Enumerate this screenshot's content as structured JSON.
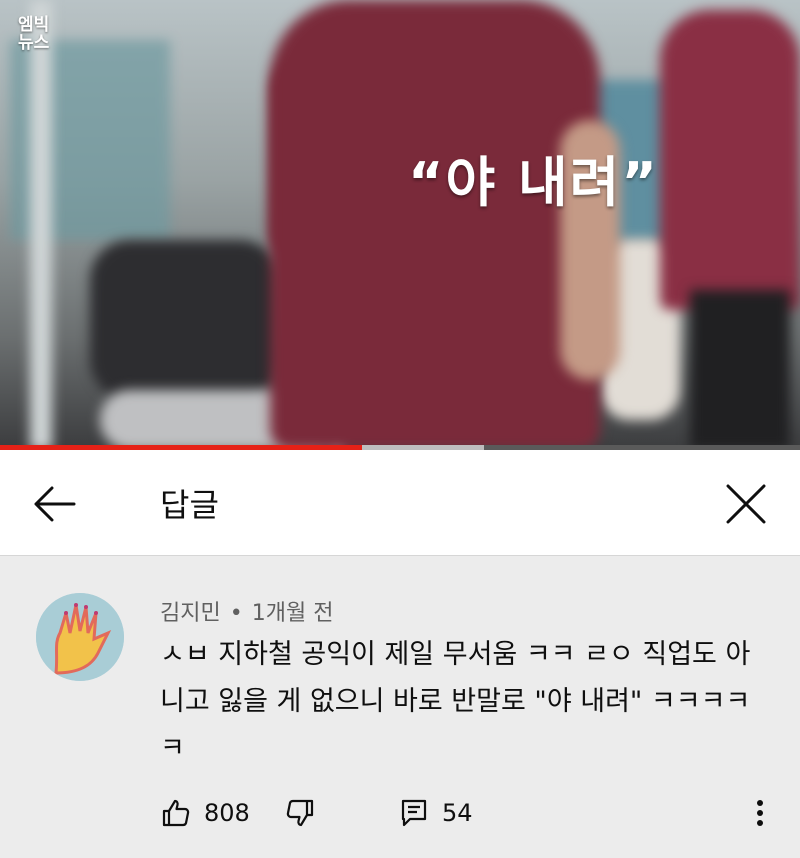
{
  "video": {
    "channel_logo": "엠빅\n뉴스",
    "caption": "“야 내려”",
    "progress_fraction": 0.4525,
    "buffered_end_fraction": 0.605
  },
  "header": {
    "title": "답글",
    "back_icon": "arrow-left-icon",
    "close_icon": "close-icon"
  },
  "comment": {
    "author": "김지민",
    "separator": "•",
    "time": "1개월 전",
    "text": "ㅅㅂ 지하철 공익이 제일 무서움 ㅋㅋ ㄹㅇ 직업도 아니고 잃을 게 없으니 바로 반말로 \"야 내려\" ㅋㅋㅋㅋㅋ",
    "likes": "808",
    "replies": "54",
    "icons": {
      "like": "thumbs-up-icon",
      "dislike": "thumbs-down-icon",
      "reply": "reply-icon",
      "more": "more-vertical-icon"
    }
  },
  "colors": {
    "progress": "#e62117",
    "header_bg": "#ffffff",
    "comment_bg": "#ececec"
  }
}
